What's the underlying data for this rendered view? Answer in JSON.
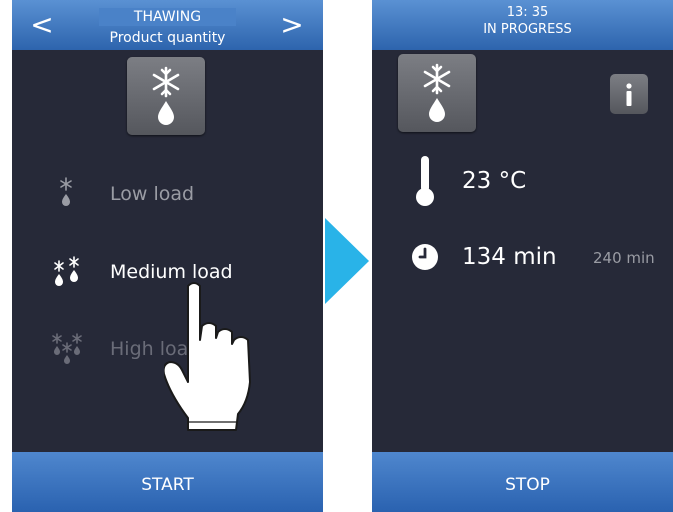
{
  "left_screen": {
    "header": {
      "title": "THAWING",
      "subtitle": "Product quantity",
      "prev_label": "<",
      "next_label": ">"
    },
    "options": [
      {
        "label": "Low load",
        "icon": "single-snowflake-drop-icon"
      },
      {
        "label": "Medium load",
        "icon": "double-snowflake-drop-icon"
      },
      {
        "label": "High load",
        "icon": "triple-snowflake-drop-icon"
      }
    ],
    "main_icon": "thaw-snowflake-drop-icon",
    "start_label": "START"
  },
  "right_screen": {
    "header": {
      "time": "13: 35",
      "status": "IN PROGRESS"
    },
    "main_icon": "thaw-snowflake-drop-icon",
    "info_icon": "info-icon",
    "temperature": {
      "value": "23 °C",
      "icon": "thermometer-icon"
    },
    "time": {
      "value": "134 min",
      "total": "240 min",
      "icon": "clock-icon"
    },
    "stop_label": "STOP"
  },
  "colors": {
    "background": "#262938",
    "header_blue": "#3d74bf",
    "arrow_cyan": "#29b3e8",
    "tile_gray": "#6a6c72"
  }
}
